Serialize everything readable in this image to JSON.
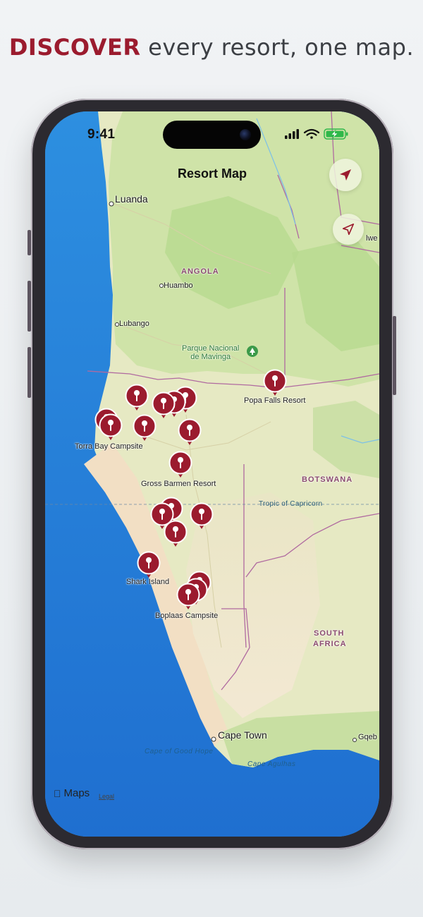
{
  "headline": {
    "accent": "DISCOVER",
    "rest": "every resort, one map."
  },
  "status_bar": {
    "time": "9:41"
  },
  "nav": {
    "title": "Resort Map"
  },
  "controls": {
    "location_button_icon": "location-arrow-filled-icon",
    "compass_button_icon": "location-arrow-outline-icon"
  },
  "map": {
    "countries": [
      "ANGOLA",
      "BOTSWANA",
      "SOUTH",
      "AFRICA"
    ],
    "cities": [
      "Luanda",
      "Huambo",
      "Lubango",
      "Cape Town",
      "Gqeb",
      "lwe"
    ],
    "park": {
      "line1": "Parque Nacional",
      "line2": "de Mavinga"
    },
    "water": [
      "Cape of Good Hope",
      "Cape Agulhas"
    ],
    "tropic": "Tropic of Capricorn",
    "resort_labels": [
      "Popa Falls Resort",
      "Torra Bay Campsite",
      "Gross Barmen Resort",
      "Shark Island",
      "Boplaas Campsite"
    ],
    "pin_color": "#9b1b2e"
  },
  "attribution": {
    "brand": "Maps",
    "legal": "Legal"
  }
}
